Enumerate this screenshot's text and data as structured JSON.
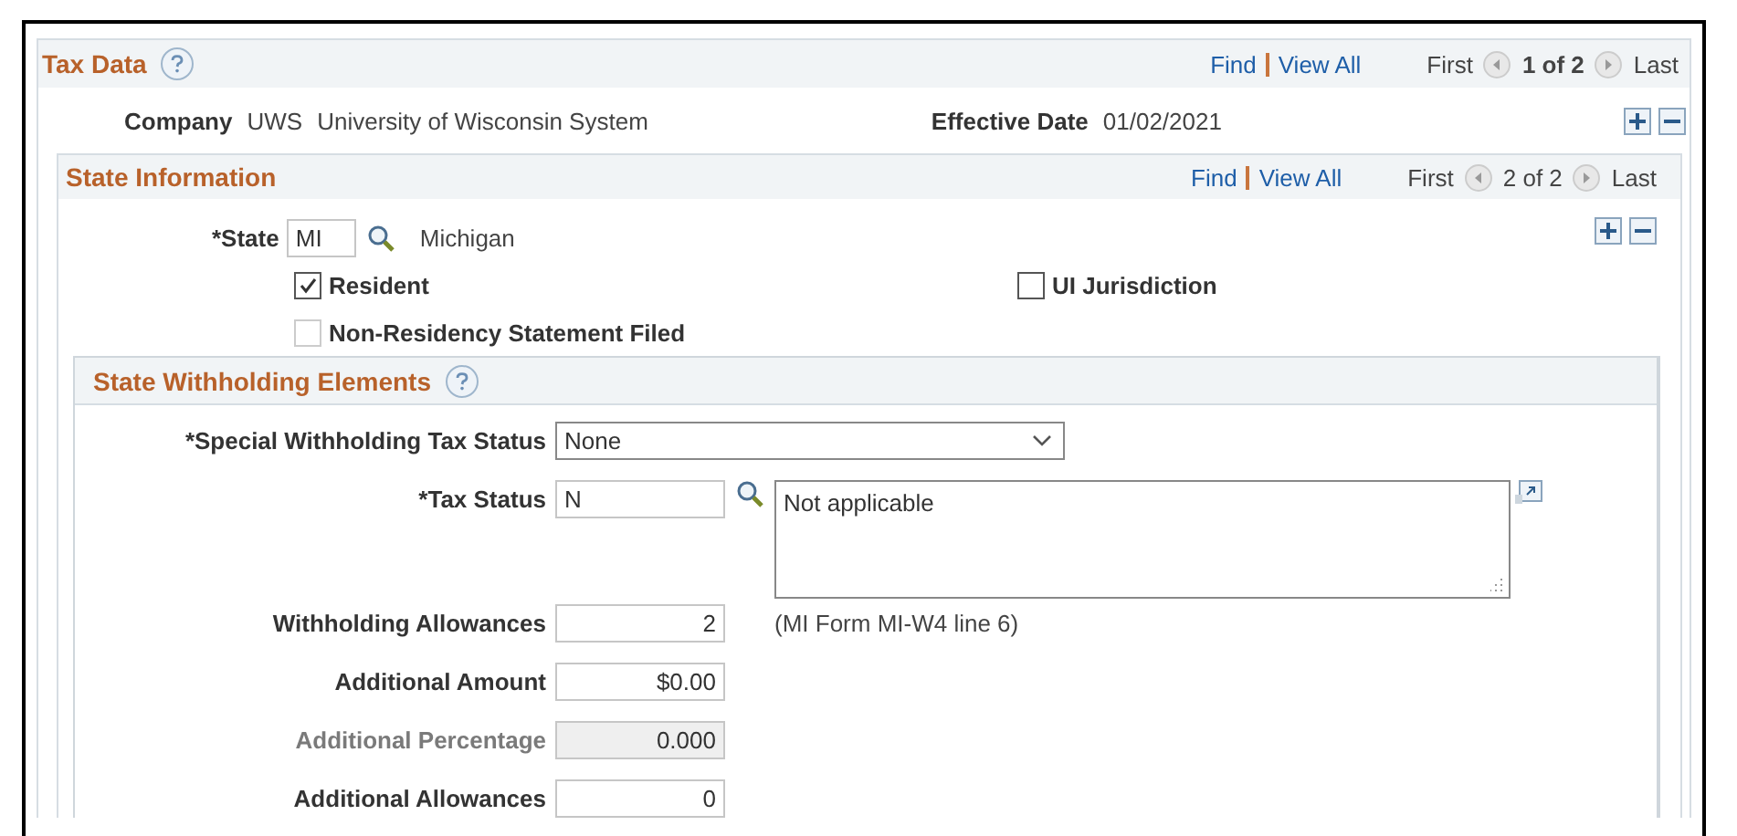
{
  "tax_data": {
    "title": "Tax Data",
    "find": "Find",
    "view_all": "View All",
    "first": "First",
    "page": "1 of 2",
    "last": "Last",
    "company_label": "Company",
    "company_code": "UWS",
    "company_name": "University of Wisconsin System",
    "effective_date_label": "Effective Date",
    "effective_date": "01/02/2021"
  },
  "state_information": {
    "title": "State Information",
    "find": "Find",
    "view_all": "View All",
    "first": "First",
    "page": "2 of 2",
    "last": "Last",
    "state_label": "*State",
    "state_value": "MI",
    "state_name": "Michigan",
    "checkboxes": [
      {
        "label": "Resident",
        "checked": true,
        "disabled": false
      },
      {
        "label": "UI Jurisdiction",
        "checked": false,
        "disabled": false
      },
      {
        "label": "Non-Residency Statement Filed",
        "checked": false,
        "disabled": true
      }
    ]
  },
  "state_withholding_elements": {
    "title": "State Withholding Elements",
    "special_label": "*Special Withholding Tax Status",
    "special_value": "None",
    "tax_status_label": "*Tax Status",
    "tax_status_value": "N",
    "tax_status_description": "Not applicable",
    "fields": [
      {
        "label": "Withholding Allowances",
        "value": "2",
        "disabled": false,
        "note": "(MI Form MI-W4 line 6)"
      },
      {
        "label": "Additional Amount",
        "value": "$0.00",
        "disabled": false
      },
      {
        "label": "Additional Percentage",
        "value": "0.000",
        "disabled": true
      },
      {
        "label": "Additional Allowances",
        "value": "0",
        "disabled": false
      }
    ]
  }
}
